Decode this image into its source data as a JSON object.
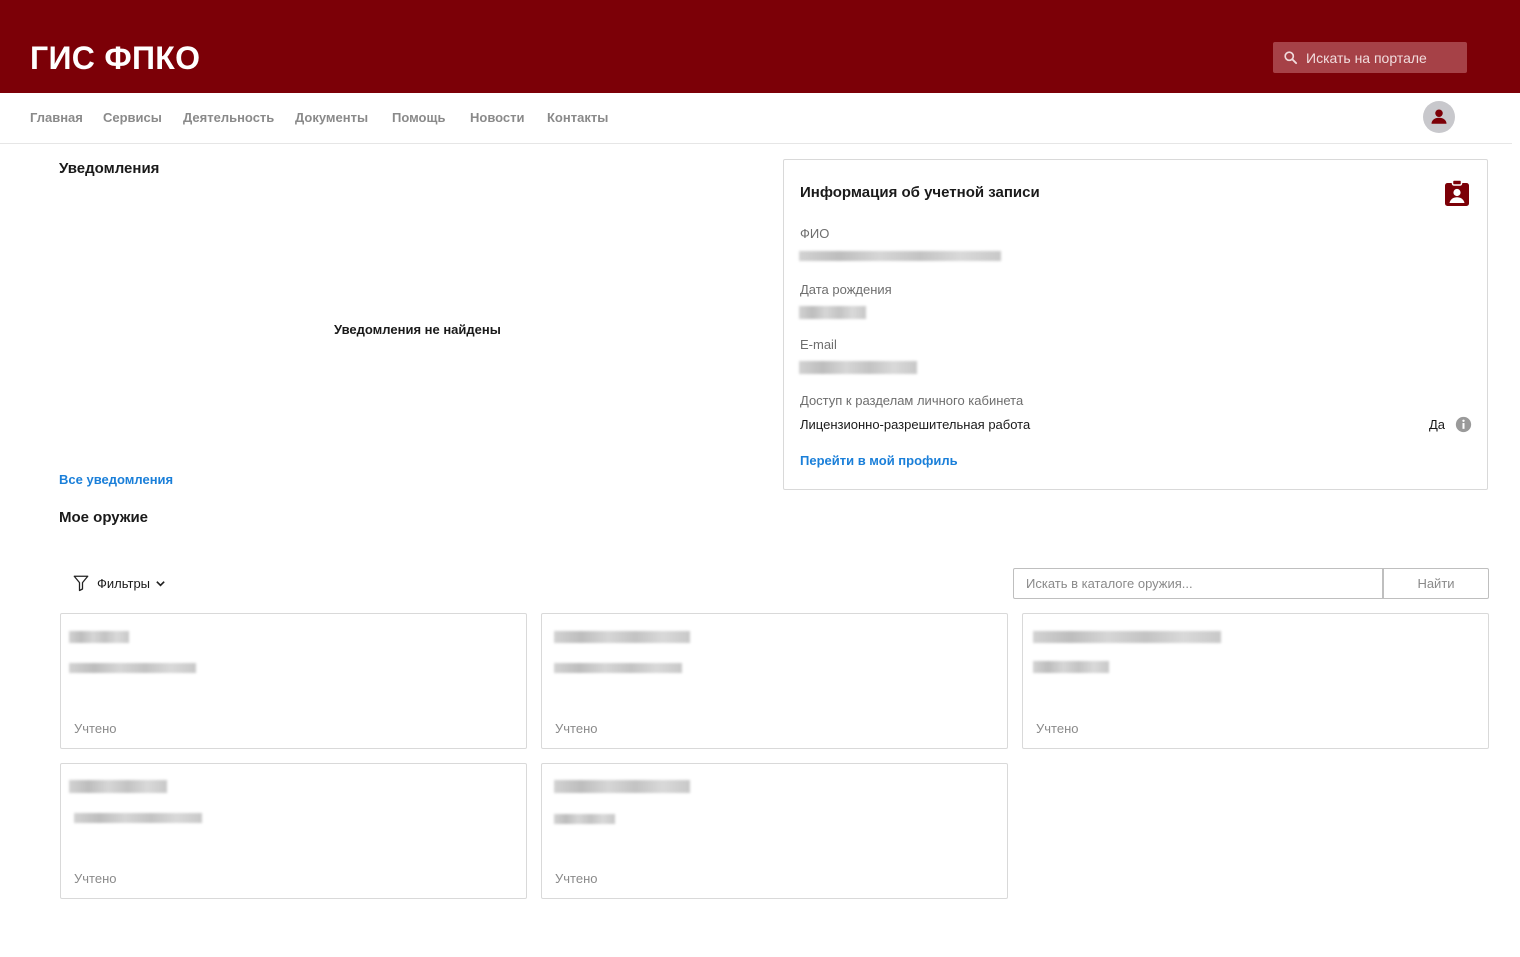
{
  "header": {
    "logo": "ГИС ФПКО",
    "search_placeholder": "Искать на портале",
    "brand_color": "#7c0007"
  },
  "nav": {
    "items": [
      "Главная",
      "Сервисы",
      "Деятельность",
      "Документы",
      "Помощь",
      "Новости",
      "Контакты"
    ]
  },
  "notifications": {
    "title": "Уведомления",
    "empty_message": "Уведомления не найдены",
    "all_link": "Все уведомления"
  },
  "account": {
    "title": "Информация об учетной записи",
    "fio_label": "ФИО",
    "birth_label": "Дата рождения",
    "email_label": "E-mail",
    "access_label": "Доступ к разделам личного кабинета",
    "access_section": "Лицензионно-разрешительная работа",
    "access_value": "Да",
    "profile_link": "Перейти в мой профиль"
  },
  "weapons": {
    "title": "Мое оружие",
    "filters_label": "Фильтры",
    "search_placeholder": "Искать в каталоге оружия...",
    "find_button": "Найти",
    "cards": [
      {
        "status": "Учтено"
      },
      {
        "status": "Учтено"
      },
      {
        "status": "Учтено"
      },
      {
        "status": "Учтено"
      },
      {
        "status": "Учтено"
      }
    ]
  },
  "colors": {
    "accent": "#7c0007",
    "link": "#1a7fd9"
  }
}
